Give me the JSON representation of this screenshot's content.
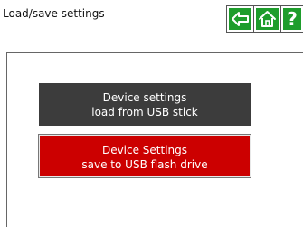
{
  "header": {
    "title": "Load/save settings",
    "buttons": {
      "back_icon": "arrow-left-icon",
      "home_icon": "home-icon",
      "help_label": "?"
    },
    "accent_color": "#1e9d2c"
  },
  "actions": {
    "load": {
      "line1": "Device settings",
      "line2": "load from USB stick",
      "color": "#3c3c3c"
    },
    "save": {
      "line1": "Device Settings",
      "line2": "save to USB flash drive",
      "color": "#cc0000"
    }
  }
}
